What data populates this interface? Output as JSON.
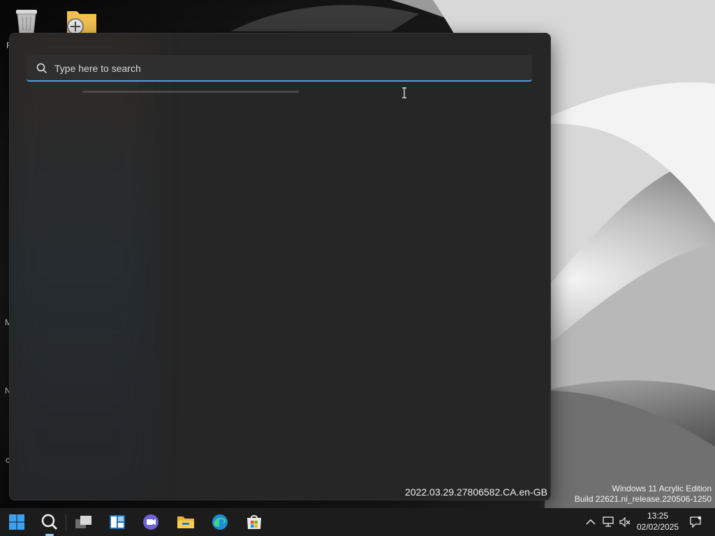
{
  "desktop": {
    "label_fragments": [
      "R",
      "M",
      "N",
      "c"
    ]
  },
  "search": {
    "placeholder": "Type here to search",
    "value": "",
    "progress": 0.0
  },
  "flyout": {
    "version": "2022.03.29.27806582.CA.en-GB"
  },
  "watermark": {
    "line1": "Windows 11 Acrylic Edition",
    "line2": "Build 22621.ni_release.220506-1250"
  },
  "taskbar": {
    "items": [
      {
        "name": "start-button",
        "icon": "windows-logo-icon"
      },
      {
        "name": "search-button",
        "icon": "search-icon"
      },
      {
        "name": "task-view-button",
        "icon": "task-view-icon"
      },
      {
        "name": "widgets-button",
        "icon": "widgets-icon"
      },
      {
        "name": "chat-button",
        "icon": "teams-chat-icon"
      },
      {
        "name": "file-explorer-button",
        "icon": "folder-icon"
      },
      {
        "name": "edge-button",
        "icon": "edge-icon"
      },
      {
        "name": "store-button",
        "icon": "store-icon"
      }
    ],
    "clock": {
      "time": "13:25",
      "date": "02/02/2025"
    }
  },
  "colors": {
    "accent": "#4aa3df",
    "flyout_bg": "#262626",
    "taskbar_bg": "#1c1c1c"
  }
}
